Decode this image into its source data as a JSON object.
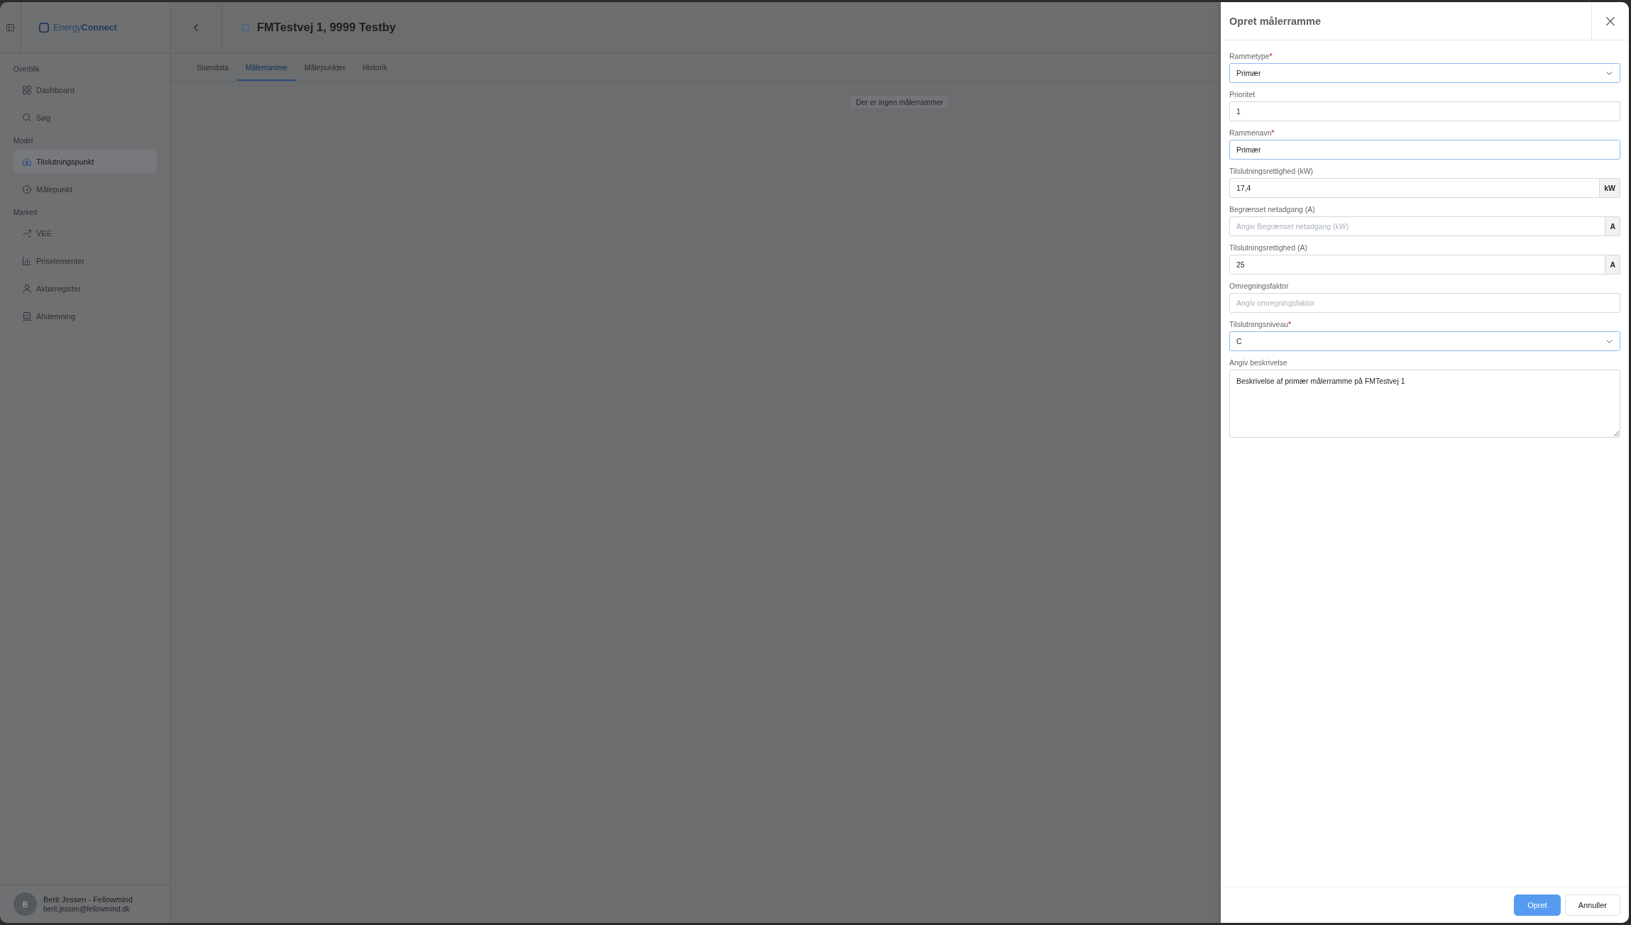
{
  "sidebar": {
    "brand": "Energy**Connect**",
    "sections": [
      {
        "heading": "Overblik",
        "items": [
          {
            "label": "Dashboard",
            "selected": false
          },
          {
            "label": "Søg",
            "selected": false
          }
        ]
      },
      {
        "heading": "Model",
        "items": [
          {
            "label": "Tilslutningspunkt",
            "selected": true
          },
          {
            "label": "Målepunkt",
            "selected": false
          }
        ]
      },
      {
        "heading": "Marked",
        "items": [
          {
            "label": "VEE",
            "selected": false
          },
          {
            "label": "Priselementer",
            "selected": false
          },
          {
            "label": "Aktørregister",
            "selected": false
          },
          {
            "label": "Afstemning",
            "selected": false
          }
        ]
      }
    ],
    "user": {
      "initial": "B",
      "name": "Berit Jessen - Fellowmind",
      "email": "berit.jessen@fellowmind.dk"
    }
  },
  "page": {
    "title": "FMTestvej 1, 9999 Testby",
    "tabs": [
      {
        "label": "Stamdata",
        "selected": false
      },
      {
        "label": "Målerramme",
        "selected": true
      },
      {
        "label": "Målepunkter",
        "selected": false
      },
      {
        "label": "Historik",
        "selected": false
      }
    ],
    "empty_message": "Der er ingen målerrammer"
  },
  "dialog": {
    "title": "Opret målerramme",
    "fields": [
      {
        "kind": "select",
        "label": "Rammetype",
        "required_mark": "*",
        "value": "Primær",
        "highlighted": true
      },
      {
        "kind": "text",
        "label": "Prioritet",
        "value": "1",
        "highlighted": false
      },
      {
        "kind": "text",
        "label": "Rammenavn",
        "required_mark": "*",
        "value": "Primær",
        "highlighted": true
      },
      {
        "kind": "unit",
        "label": "Tilslutningsrettighed (kW)",
        "value": "17,4",
        "unit": "kW",
        "highlighted": false
      },
      {
        "kind": "unit",
        "label": "Begrænset netadgang (A)",
        "placeholder": "Angiv Begrænset netadgang (kW)",
        "unit": "A",
        "highlighted": false
      },
      {
        "kind": "unit",
        "label": "Tilslutningsrettighed (A)",
        "value": "25",
        "unit": "A",
        "highlighted": false
      },
      {
        "kind": "text",
        "label": "Omregningsfaktor",
        "placeholder": "Angiv omregningsfaktor",
        "highlighted": false
      },
      {
        "kind": "select",
        "label": "Tilslutningsniveau",
        "required_mark": "*",
        "value": "C",
        "highlighted": true
      },
      {
        "kind": "textarea",
        "label": "Angiv beskrivelse",
        "value": "Beskrivelse af primær målerramme på FMTestvej 1",
        "highlighted": false
      }
    ],
    "buttons": [
      {
        "label": "Opret",
        "kind": "primary"
      },
      {
        "label": "Annuller",
        "kind": "secondary"
      }
    ]
  }
}
